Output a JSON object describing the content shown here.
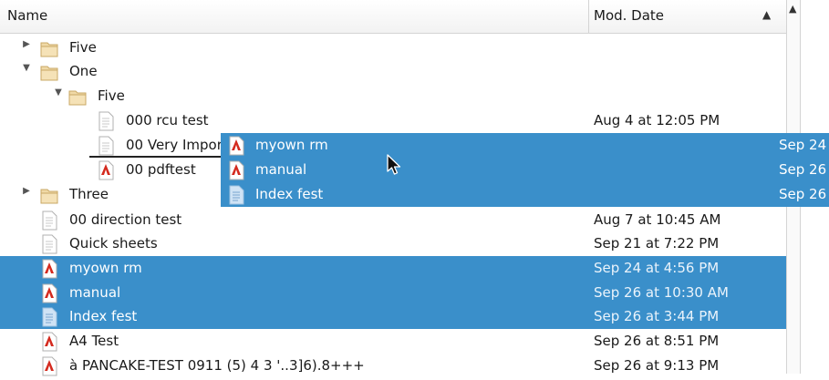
{
  "header": {
    "name": "Name",
    "date": "Mod. Date",
    "sort_icon": "triangle-up-icon"
  },
  "rows": [
    {
      "label": "Five",
      "date": "",
      "disc": "collapsed",
      "icon": "folder"
    },
    {
      "label": "One",
      "date": "",
      "disc": "expanded",
      "icon": "folder"
    },
    {
      "label": "Five",
      "date": "",
      "disc": "expanded",
      "icon": "folder"
    },
    {
      "label": "000 rcu test",
      "date": "Aug 4 at 12:05 PM",
      "disc": "",
      "icon": "doc"
    },
    {
      "label": "00 Very Important",
      "date": "",
      "disc": "",
      "icon": "doc"
    },
    {
      "label": "00 pdftest",
      "date": "",
      "disc": "",
      "icon": "pdf"
    },
    {
      "label": "Three",
      "date": "",
      "disc": "collapsed",
      "icon": "folder"
    },
    {
      "label": "00 direction test",
      "date": "Aug 7 at 10:45 AM",
      "disc": "",
      "icon": "doc"
    },
    {
      "label": "Quick sheets",
      "date": "Sep 21 at 7:22 PM",
      "disc": "",
      "icon": "doc"
    },
    {
      "label": "myown rm",
      "date": "Sep 24 at 4:56 PM",
      "disc": "",
      "icon": "pdf",
      "selected": true
    },
    {
      "label": "manual",
      "date": "Sep 26 at 10:30 AM",
      "disc": "",
      "icon": "pdf",
      "selected": true
    },
    {
      "label": "Index fest",
      "date": "Sep 26 at 3:44 PM",
      "disc": "",
      "icon": "doc-blue",
      "selected": true
    },
    {
      "label": "A4 Test",
      "date": "Sep 26 at 8:51 PM",
      "disc": "",
      "icon": "pdf"
    },
    {
      "label": "à PANCAKE-TEST 0911 (5) 4 3 '..3]6).8+++",
      "date": "Sep 26 at 9:13 PM",
      "disc": "",
      "icon": "pdf"
    }
  ],
  "drag_items": [
    {
      "label": "myown rm",
      "date": "Sep 24",
      "icon": "pdf"
    },
    {
      "label": "manual",
      "date": "Sep 26",
      "icon": "pdf"
    },
    {
      "label": "Index fest",
      "date": "Sep 26",
      "icon": "doc-blue"
    }
  ]
}
